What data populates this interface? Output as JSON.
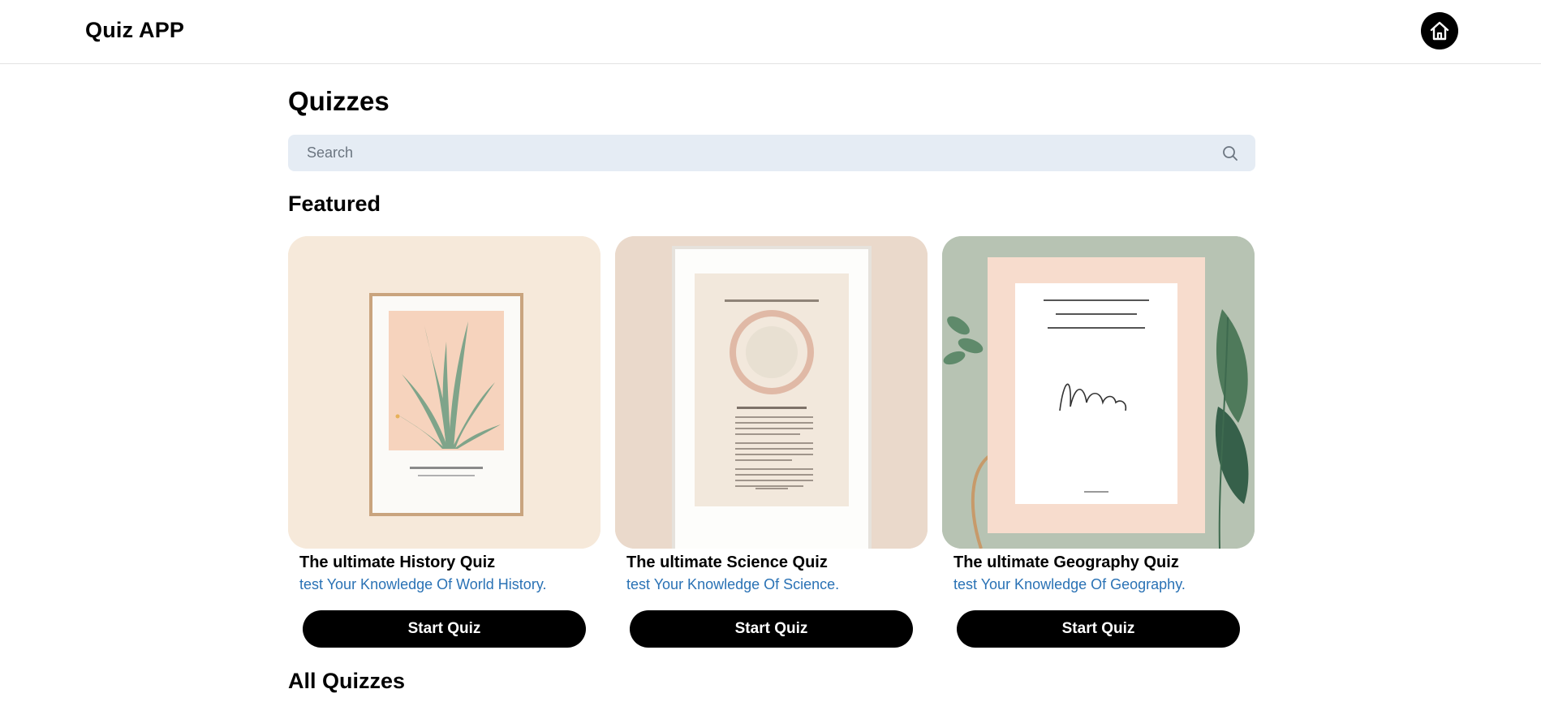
{
  "app": {
    "title": "Quiz APP",
    "home_icon": "home-icon"
  },
  "page": {
    "title": "Quizzes"
  },
  "search": {
    "placeholder": "Search",
    "value": "",
    "icon": "search-icon"
  },
  "sections": {
    "featured": "Featured",
    "all": "All Quizzes"
  },
  "featured": [
    {
      "title": "The ultimate History Quiz",
      "description": "test Your Knowledge Of World History.",
      "button": "Start Quiz",
      "image_alt": "framed plant art print",
      "bg_color": "#f6e9da"
    },
    {
      "title": "The ultimate Science Quiz",
      "description": "test Your Knowledge Of Science.",
      "button": "Start Quiz",
      "image_alt": "framed circle poster print",
      "bg_color": "#ead9cb"
    },
    {
      "title": "The ultimate Geography Quiz",
      "description": "test Your Knowledge Of Geography.",
      "button": "Start Quiz",
      "image_alt": "framed script poster with leaves",
      "bg_color": "#b7c3b3"
    }
  ],
  "colors": {
    "accent_link": "#2a72b5",
    "search_bg": "#e5ecf4",
    "button_bg": "#000000"
  }
}
